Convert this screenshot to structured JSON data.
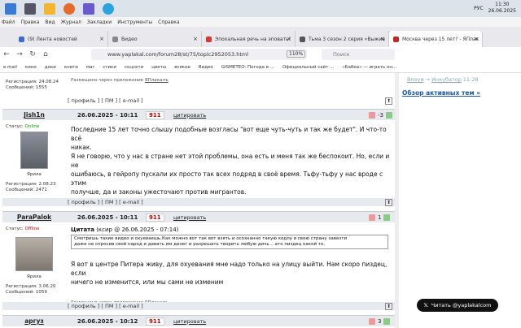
{
  "taskbar": {
    "time": "11:30",
    "date": "26.06.2025",
    "lang": "РУС"
  },
  "menu": [
    "Файл",
    "Правка",
    "Вид",
    "Журнал",
    "Закладки",
    "Инструменты",
    "Справка"
  ],
  "tabs": [
    {
      "label": "(9) Лента новостей",
      "color": "#3b6bd6",
      "active": false
    },
    {
      "label": "Видео",
      "color": "#888",
      "active": false
    },
    {
      "label": "Эпохальная речь на эповать!",
      "color": "#d33",
      "active": false
    },
    {
      "label": "Тьма 3 сезон 2 серия «Выжив",
      "color": "#555",
      "active": false
    },
    {
      "label": "Москва через 15 лет? - ЯПлак",
      "color": "#c22",
      "active": true
    }
  ],
  "nav": {
    "url": "www.yaplakal.com/forum28/st/75/topic2952053.html",
    "zoom": "110%",
    "search_placeholder": "Поиск"
  },
  "bookmarks": [
    "e.mail",
    "кино",
    "доки",
    "книги",
    "маг",
    "стики",
    "соцсети",
    "цветы",
    "всякое",
    "Видео",
    "GISMETEO: Погода в ...",
    "Официальный сайт ...",
    "«Бабеа» — играть он..."
  ],
  "top_post": {
    "posted_via": "Размещено через приложение",
    "app": "ЯПлакалъ",
    "reg": "Регистрация: 24.08.24",
    "msgs": "Сообщений: 1555"
  },
  "links": "[ профиль ] [ ПМ ] [ e-mail ]",
  "posts": [
    {
      "author": "Jish1n",
      "date": "26.06.2025 - 10:11",
      "votes": "911",
      "quote": "цитировать",
      "score": "-3",
      "status_label": "Статус:",
      "status": "Online",
      "rank": "Ярила",
      "reg": "Регистрация: 2.08.23",
      "msgs": "Сообщений: 2471",
      "lines": [
        "Последние 15 лет точно слышу подобные возгласы \"вот еще чуть-чуть и так же будет\". И что-то всё",
        "никак.",
        "Я не говорю, что у нас в стране нет этой проблемы, она есть и меня так же беспокоит. Но, если и не",
        "ошибаюсь, в гейропу пускали их просто так всех подряд в своё время. Тьфу-тьфу у нас вроде с этим",
        "получше, да и законы ужесточают против мигрантов."
      ]
    },
    {
      "author": "ParaPalok",
      "date": "26.06.2025 - 10:11",
      "votes": "911",
      "quote": "цитировать",
      "score": "1",
      "status_label": "Статус:",
      "status": "Offline",
      "rank": "Ярила",
      "reg": "Регистрация: 3.06.20",
      "msgs": "Сообщений: 1059",
      "quote_title": "Цитата",
      "quote_meta": "(ксир @ 26.06.2025 - 07:14)",
      "quote_lines": [
        "Смотришь такие видео и охуеваешь.Как можно вот так вот взять и осознанно такую кодлу в свою страну завезти",
        "даже не спросив свой народ и давать им денег и разрешать творить любую дичь ...ато пиздец какой то."
      ],
      "lines": [
        "Я вот в центре Питера живу, для охуевания мне надо только на улицу выйти. Нам скоро пиздец, если",
        "ничего не изменится, или мы сами не изменим"
      ]
    },
    {
      "author": "аргуз",
      "date": "26.06.2025 - 10:12",
      "votes": "911",
      "quote": "цитировать",
      "score": "3"
    }
  ],
  "sidebar": {
    "who": "Впоуя",
    "arrow": "→",
    "group": "Инкубатор",
    "time": "11:28",
    "overview": "Обзор активных тем »"
  },
  "twitter": "Читать @yaplakalcom"
}
